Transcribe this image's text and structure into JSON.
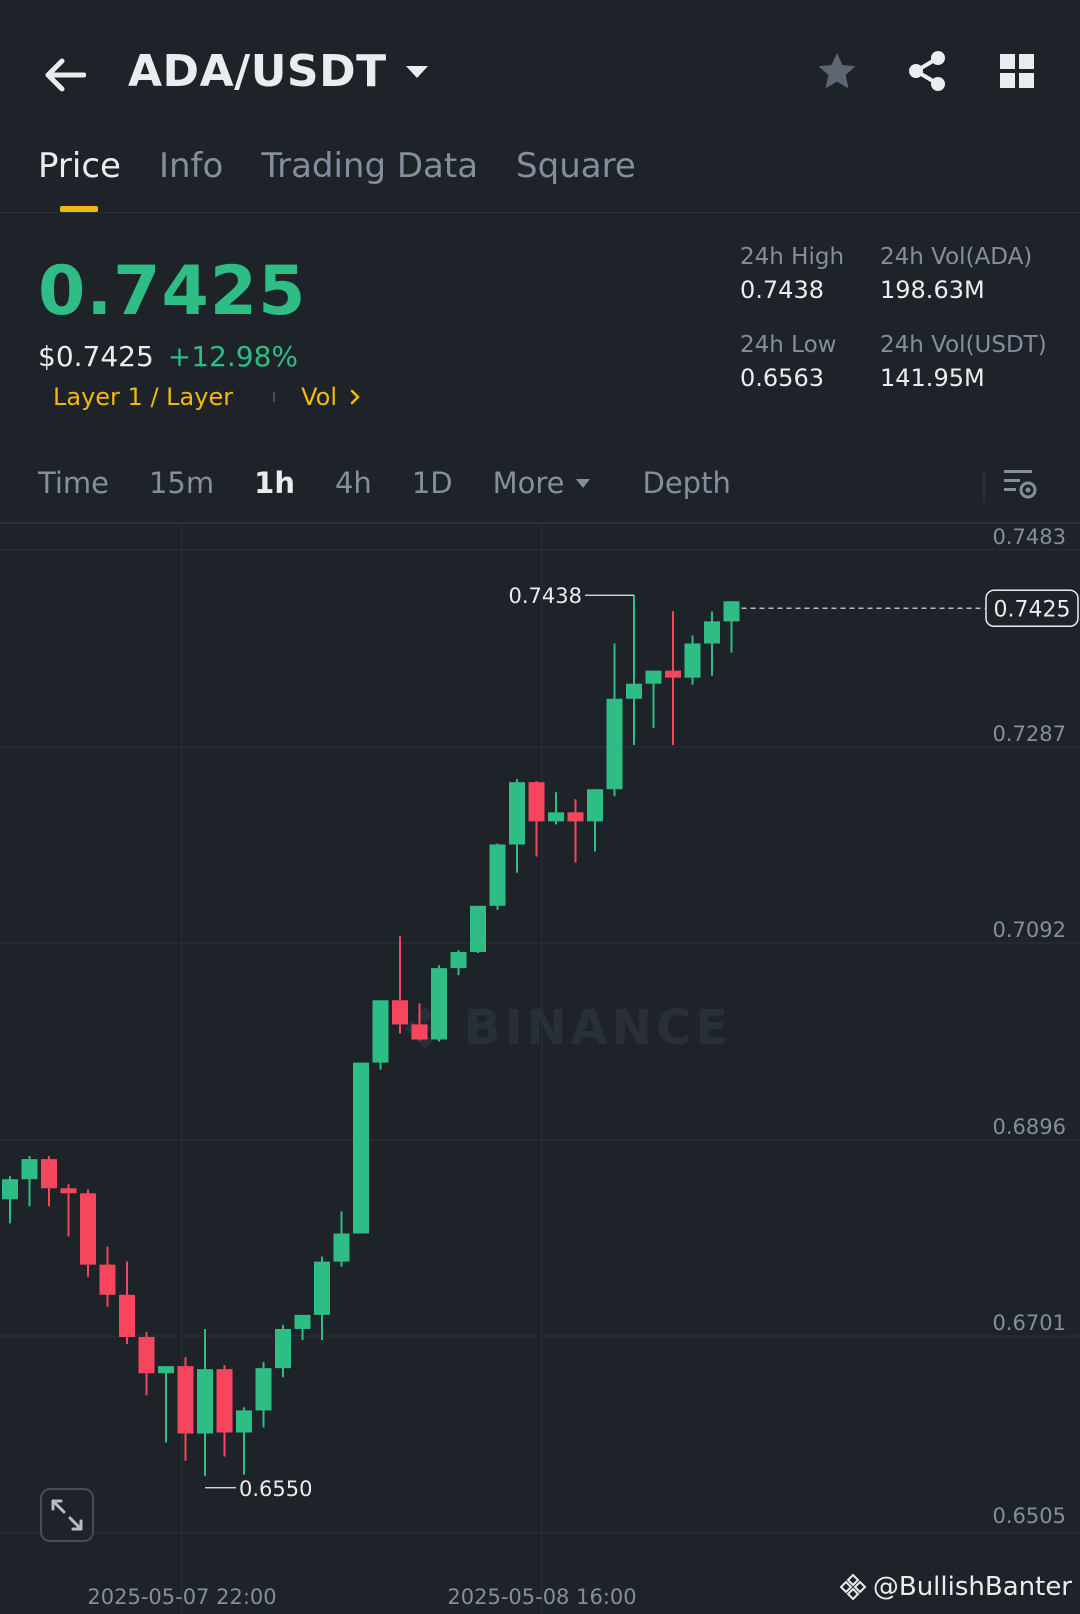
{
  "header": {
    "pair": "ADA/USDT",
    "back_icon": "arrow-left-icon",
    "icons": [
      "star-icon",
      "share-icon",
      "grid-icon"
    ]
  },
  "tabs": [
    {
      "label": "Price",
      "active": true
    },
    {
      "label": "Info",
      "active": false
    },
    {
      "label": "Trading Data",
      "active": false
    },
    {
      "label": "Square",
      "active": false
    }
  ],
  "price": {
    "last": "0.7425",
    "usd": "$0.7425",
    "change": "+12.98%",
    "tag_category": "Layer 1 / Layer",
    "tag_vol": "Vol"
  },
  "stats": {
    "high_label": "24h High",
    "high_value": "0.7438",
    "low_label": "24h Low",
    "low_value": "0.6563",
    "vol_base_label": "24h Vol(ADA)",
    "vol_base_value": "198.63M",
    "vol_quote_label": "24h Vol(USDT)",
    "vol_quote_value": "141.95M"
  },
  "timeframes": {
    "items": [
      "Time",
      "15m",
      "1h",
      "4h",
      "1D"
    ],
    "active": "1h",
    "more": "More",
    "depth": "Depth"
  },
  "colors": {
    "up": "#2ebd85",
    "down": "#f6465d",
    "accent": "#f0b90b",
    "bg": "#1e2329"
  },
  "watermark": "BINANCE",
  "credit": "@BullishBanter",
  "chart_data": {
    "type": "candlestick",
    "ylim": [
      0.6505,
      0.7483
    ],
    "y_ticks": [
      "0.7483",
      "0.7287",
      "0.7092",
      "0.6896",
      "0.6701",
      "0.6505"
    ],
    "x_ticks": [
      "2025-05-07 22:00",
      "2025-05-08 16:00"
    ],
    "last_price_label": "0.7425",
    "high_marker": "0.7438",
    "low_marker": "0.6550",
    "candles": [
      {
        "o": 0.6837,
        "h": 0.686,
        "l": 0.6813,
        "c": 0.6857
      },
      {
        "o": 0.6857,
        "h": 0.688,
        "l": 0.683,
        "c": 0.6877
      },
      {
        "o": 0.6877,
        "h": 0.688,
        "l": 0.683,
        "c": 0.6848
      },
      {
        "o": 0.6848,
        "h": 0.6852,
        "l": 0.68,
        "c": 0.6843
      },
      {
        "o": 0.6843,
        "h": 0.6847,
        "l": 0.676,
        "c": 0.6772
      },
      {
        "o": 0.6772,
        "h": 0.679,
        "l": 0.673,
        "c": 0.6742
      },
      {
        "o": 0.6742,
        "h": 0.6775,
        "l": 0.6693,
        "c": 0.67
      },
      {
        "o": 0.67,
        "h": 0.6705,
        "l": 0.6642,
        "c": 0.6664
      },
      {
        "o": 0.6664,
        "h": 0.667,
        "l": 0.6595,
        "c": 0.6671
      },
      {
        "o": 0.6671,
        "h": 0.668,
        "l": 0.6577,
        "c": 0.6604
      },
      {
        "o": 0.6604,
        "h": 0.6708,
        "l": 0.6562,
        "c": 0.6668
      },
      {
        "o": 0.6668,
        "h": 0.6672,
        "l": 0.6581,
        "c": 0.6605
      },
      {
        "o": 0.6605,
        "h": 0.663,
        "l": 0.6563,
        "c": 0.6627
      },
      {
        "o": 0.6627,
        "h": 0.6675,
        "l": 0.661,
        "c": 0.6669
      },
      {
        "o": 0.6669,
        "h": 0.6712,
        "l": 0.666,
        "c": 0.6708
      },
      {
        "o": 0.6708,
        "h": 0.6722,
        "l": 0.6697,
        "c": 0.6722
      },
      {
        "o": 0.6722,
        "h": 0.678,
        "l": 0.6697,
        "c": 0.6775
      },
      {
        "o": 0.6775,
        "h": 0.6825,
        "l": 0.677,
        "c": 0.6803
      },
      {
        "o": 0.6803,
        "h": 0.697,
        "l": 0.6803,
        "c": 0.6973
      },
      {
        "o": 0.6973,
        "h": 0.7035,
        "l": 0.6966,
        "c": 0.7035
      },
      {
        "o": 0.7035,
        "h": 0.7099,
        "l": 0.7002,
        "c": 0.7011
      },
      {
        "o": 0.7011,
        "h": 0.7032,
        "l": 0.6995,
        "c": 0.6996
      },
      {
        "o": 0.6996,
        "h": 0.707,
        "l": 0.6994,
        "c": 0.7067
      },
      {
        "o": 0.7067,
        "h": 0.7085,
        "l": 0.706,
        "c": 0.7083
      },
      {
        "o": 0.7083,
        "h": 0.7122,
        "l": 0.7082,
        "c": 0.7129
      },
      {
        "o": 0.7129,
        "h": 0.7191,
        "l": 0.7125,
        "c": 0.719
      },
      {
        "o": 0.719,
        "h": 0.7255,
        "l": 0.7162,
        "c": 0.7252
      },
      {
        "o": 0.7252,
        "h": 0.7253,
        "l": 0.7178,
        "c": 0.7213
      },
      {
        "o": 0.7213,
        "h": 0.7242,
        "l": 0.721,
        "c": 0.7222
      },
      {
        "o": 0.7222,
        "h": 0.7235,
        "l": 0.7172,
        "c": 0.7213
      },
      {
        "o": 0.7213,
        "h": 0.7245,
        "l": 0.7183,
        "c": 0.7245
      },
      {
        "o": 0.7245,
        "h": 0.739,
        "l": 0.7238,
        "c": 0.7335
      },
      {
        "o": 0.7335,
        "h": 0.7438,
        "l": 0.7289,
        "c": 0.735
      },
      {
        "o": 0.735,
        "h": 0.736,
        "l": 0.7306,
        "c": 0.7363
      },
      {
        "o": 0.7363,
        "h": 0.7422,
        "l": 0.7289,
        "c": 0.7356
      },
      {
        "o": 0.7356,
        "h": 0.7398,
        "l": 0.7349,
        "c": 0.739
      },
      {
        "o": 0.739,
        "h": 0.7422,
        "l": 0.7358,
        "c": 0.7412
      },
      {
        "o": 0.7412,
        "h": 0.7432,
        "l": 0.7381,
        "c": 0.7432
      }
    ]
  }
}
